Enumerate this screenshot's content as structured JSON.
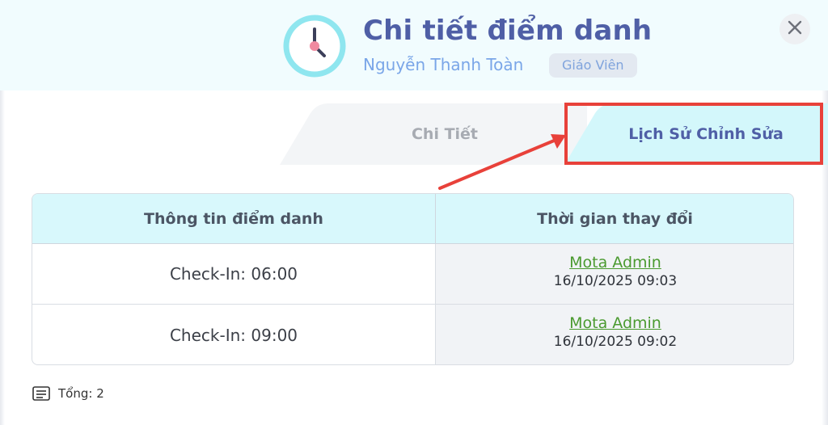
{
  "dialog": {
    "title": "Chi tiết điểm danh",
    "user_name": "Nguyễn Thanh Toàn",
    "role": "Giáo Viên",
    "icon": "clock-icon",
    "close_icon": "close-icon"
  },
  "tabs": [
    {
      "label": "Chi Tiết",
      "active": false
    },
    {
      "label": "Lịch Sử Chỉnh Sửa",
      "active": true
    }
  ],
  "table": {
    "headers": [
      "Thông tin điểm danh",
      "Thời gian thay đổi"
    ],
    "rows": [
      {
        "info": "Check-In: 06:00",
        "editor": "Mota Admin",
        "time": "16/10/2025 09:03"
      },
      {
        "info": "Check-In: 09:00",
        "editor": "Mota Admin",
        "time": "16/10/2025 09:02"
      }
    ]
  },
  "footer": {
    "total_label": "Tổng: 2",
    "icon": "list-icon"
  },
  "colors": {
    "title": "#4f5fa6",
    "header_bg": "#f1fcfe",
    "table_header_bg": "#d8f8fc",
    "active_tab_bg": "#d3f7fb",
    "link": "#4a9a2f",
    "highlight": "#e8413a"
  }
}
